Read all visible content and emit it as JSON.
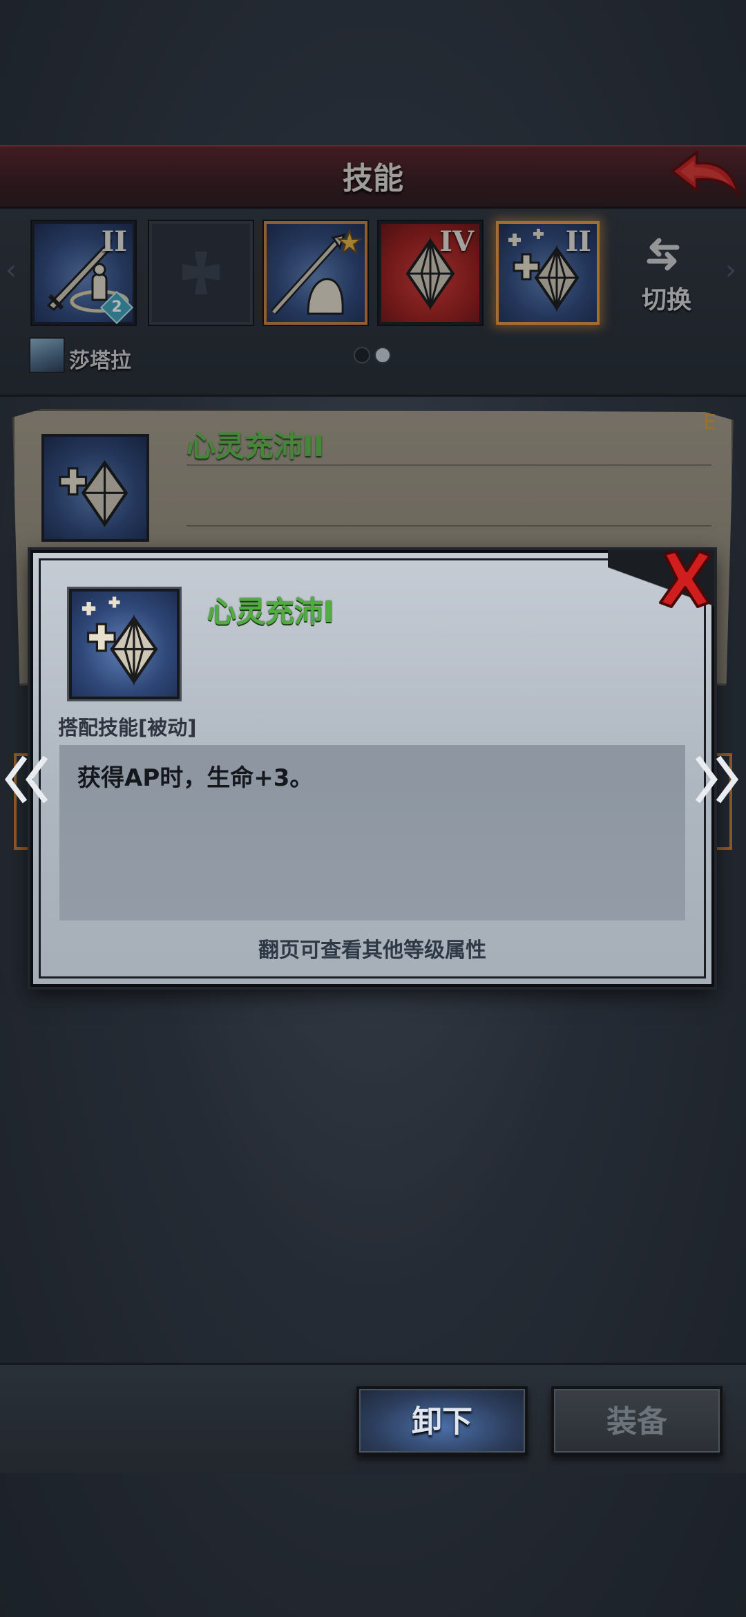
{
  "header": {
    "title": "技能",
    "back_icon": "back-arrow-icon"
  },
  "skill_slots": [
    {
      "name": "sword-summon-skill",
      "level": "II",
      "badge": "2",
      "style": "blue"
    },
    {
      "name": "empty-slot",
      "level": "",
      "style": "empty"
    },
    {
      "name": "spear-skill",
      "level": "",
      "style": "blue",
      "starred": true
    },
    {
      "name": "crystal-red-skill",
      "level": "IV",
      "style": "red"
    },
    {
      "name": "crystal-plus-skill",
      "level": "II",
      "style": "blue",
      "selected": true
    }
  ],
  "switch": {
    "label": "切换",
    "icon": "swap-arrows-icon"
  },
  "hero": {
    "name": "莎塔拉"
  },
  "page_dots": {
    "count": 2,
    "active": 1
  },
  "background_card": {
    "title": "心灵充沛II",
    "grade": "E"
  },
  "modal": {
    "title": "心灵充沛I",
    "type_label": "搭配技能[被动]",
    "description": "获得AP时，生命+3。",
    "footnote": "翻页可查看其他等级属性",
    "close_icon": "close-x-icon",
    "prev_icon": "double-chevron-left-icon",
    "next_icon": "double-chevron-right-icon"
  },
  "buttons": {
    "unequip": "卸下",
    "equip": "装备"
  },
  "colors": {
    "header_red": "#5a2328",
    "skill_green": "#4fae3f",
    "selected_orange": "#e8963a",
    "close_red": "#d01d1d"
  }
}
